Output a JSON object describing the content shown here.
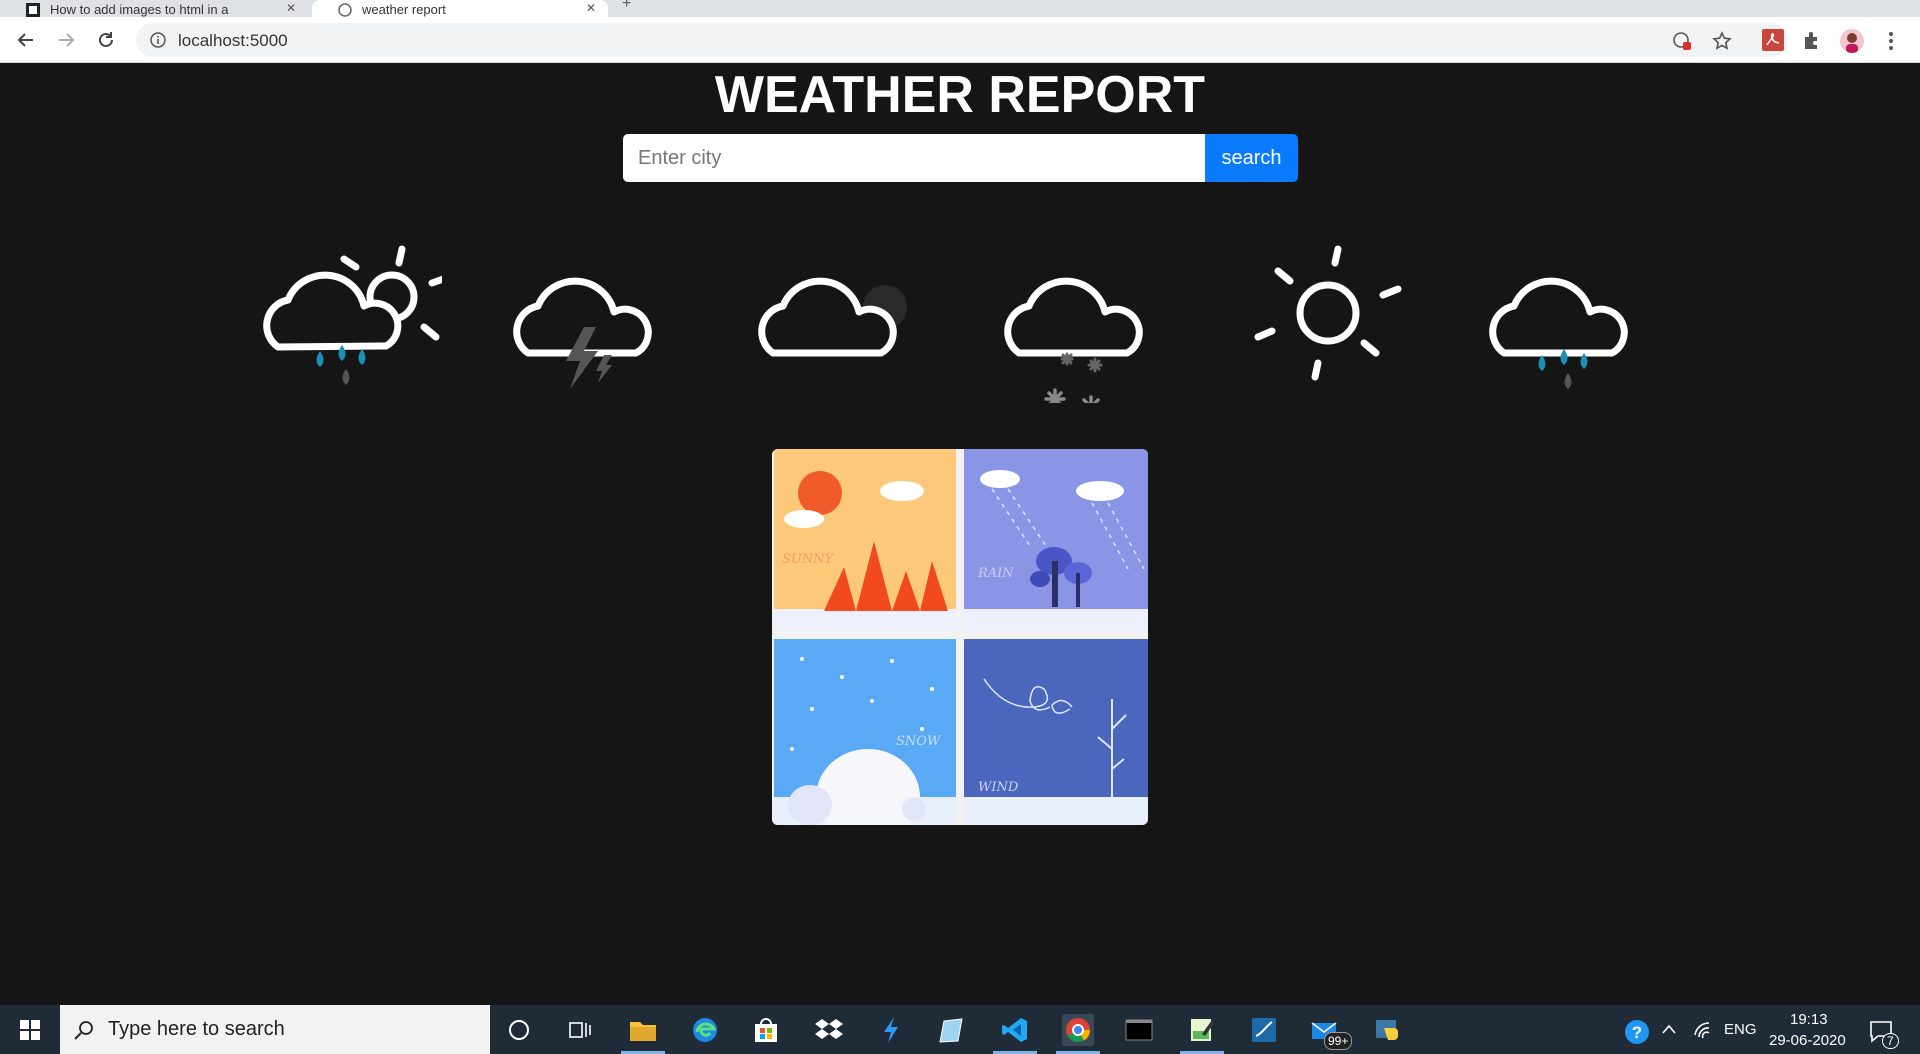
{
  "browser": {
    "tabs": [
      {
        "title": "How to add images to html in a"
      },
      {
        "title": "weather report"
      }
    ],
    "url": "localhost:5000"
  },
  "page": {
    "title": "WEATHER REPORT",
    "search": {
      "placeholder": "Enter city",
      "value": "",
      "button_label": "search"
    },
    "weather_icons": [
      "rain-sun-icon",
      "thunderstorm-icon",
      "cloudy-icon",
      "snow-icon",
      "sunny-icon",
      "rain-icon"
    ],
    "collage_labels": [
      "SUNNY",
      "RAIN",
      "SNOW",
      "WIND"
    ]
  },
  "taskbar": {
    "search_placeholder": "Type here to search",
    "mail_badge": "99+",
    "language": "ENG",
    "time": "19:13",
    "date": "29-06-2020",
    "notifications": "7"
  },
  "colors": {
    "accent": "#0a7bff",
    "background": "#151515",
    "drop": "#1b8fb5"
  }
}
